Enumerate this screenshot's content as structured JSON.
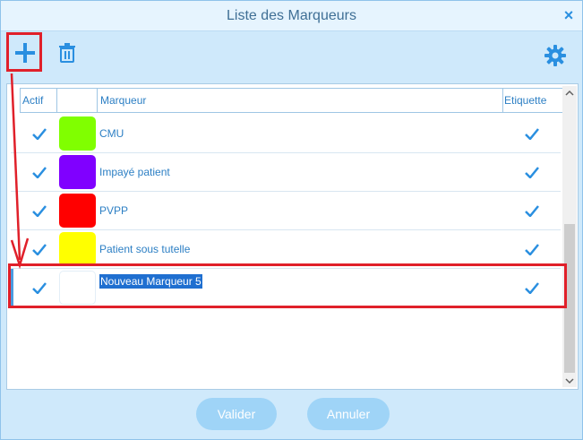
{
  "window": {
    "title": "Liste des Marqueurs",
    "close_glyph": "×"
  },
  "toolbar": {
    "add_icon": "plus-icon",
    "delete_icon": "trash-icon",
    "settings_icon": "gear-icon"
  },
  "table": {
    "headers": {
      "actif": "Actif",
      "color": "",
      "marqueur": "Marqueur",
      "etiquette": "Etiquette"
    },
    "rows": [
      {
        "actif": true,
        "color": "#80ff00",
        "marqueur": "CMU",
        "etiquette": true
      },
      {
        "actif": true,
        "color": "#8000ff",
        "marqueur": "Impayé patient",
        "etiquette": true
      },
      {
        "actif": true,
        "color": "#ff0000",
        "marqueur": "PVPP",
        "etiquette": true
      },
      {
        "actif": true,
        "color": "#ffff00",
        "marqueur": "Patient sous tutelle",
        "etiquette": true
      },
      {
        "actif": true,
        "color": "#ffffff",
        "marqueur": "Nouveau Marqueur 5",
        "etiquette": true
      }
    ]
  },
  "footer": {
    "validate_label": "Valider",
    "cancel_label": "Annuler"
  },
  "colors": {
    "accent": "#2a8fe0",
    "annotation": "#e0202a",
    "button_bg": "#9fd4f7"
  }
}
